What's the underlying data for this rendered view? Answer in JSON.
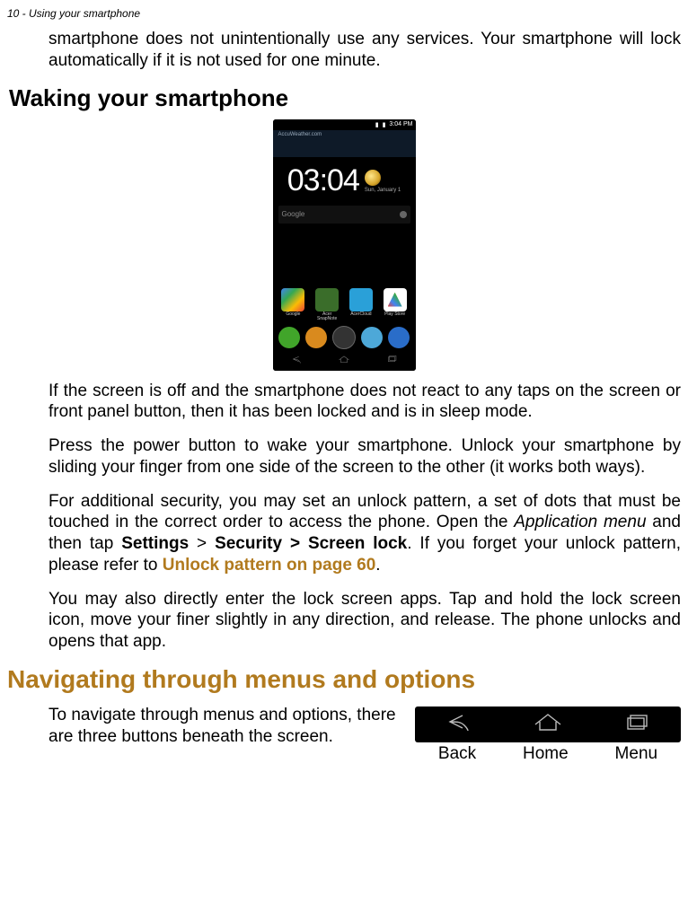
{
  "header": "10 - Using your smartphone",
  "intro_cont": "smartphone does not unintentionally use any services. Your smartphone will lock automatically if it is not used for one minute.",
  "h2_waking": "Waking your smartphone",
  "phone": {
    "status_time": "3:04 PM",
    "weather_brand": "AccuWeather.com",
    "clock": "03:04",
    "date": "Sun, January 1",
    "search": "Google",
    "apps": [
      {
        "label": "Google"
      },
      {
        "label": "Acer SnapNote"
      },
      {
        "label": "AcerCloud"
      },
      {
        "label": "Play Store"
      }
    ]
  },
  "p_if_screen": "If the screen is off and the smartphone does not react to any taps on the screen or front panel button, then it has been locked and is in sleep mode.",
  "p_press": "Press the power button to wake your smartphone. Unlock your smartphone by sliding your finger from one side of the screen to the other (it works both ways).",
  "p_security_pre": "For additional security, you may set an unlock pattern, a set of dots that must be touched in the correct order to access the phone. Open the ",
  "p_security_appmenu": "Application menu",
  "p_security_mid1": " and then tap ",
  "p_security_settings": "Settings",
  "p_security_gt1": " > ",
  "p_security_security": "Security > Screen lock",
  "p_security_mid2": ". If you forget your unlock pattern, please refer to ",
  "p_security_link": "Unlock pattern on page 60",
  "p_security_end": ".",
  "p_direct": "You may also directly enter the lock screen apps. Tap and  hold the lock screen icon, move your finer slightly in any direction, and release. The phone unlocks and opens that app.",
  "h1_nav": "Navigating through menus and options",
  "p_nav": "To navigate through menus and options, there are three buttons beneath the screen.",
  "nav_labels": {
    "back": "Back",
    "home": "Home",
    "menu": "Menu"
  }
}
